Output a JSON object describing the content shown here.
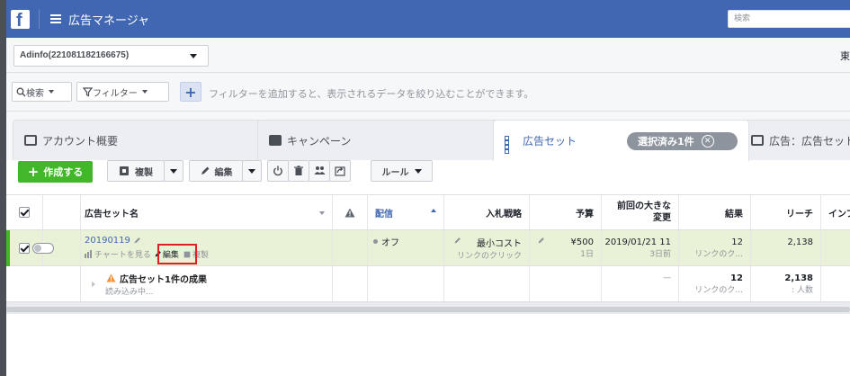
{
  "topbar": {
    "app_title": "広告マネージャ",
    "search_placeholder": "検索"
  },
  "account": {
    "selected": "Adinfo(221081182166675)",
    "right_text": "東"
  },
  "filter_bar": {
    "search_label": "検索",
    "filter_label": "フィルター",
    "hint": "フィルターを追加すると、表示されるデータを絞り込むことができます。"
  },
  "tabs": [
    {
      "label": "アカウント概要",
      "icon": "account-overview-icon"
    },
    {
      "label": "キャンペーン",
      "icon": "campaign-icon"
    },
    {
      "label": "広告セット",
      "icon": "adset-icon",
      "active": true
    },
    {
      "label": "広告：広告セット",
      "icon": "ad-icon"
    }
  ],
  "selected_pill": "選択済み1件",
  "toolbar": {
    "create": "作成する",
    "duplicate": "複製",
    "edit": "編集",
    "rules": "ルール"
  },
  "table": {
    "headers": {
      "name": "広告セット名",
      "delivery": "配信",
      "bid_strategy": "入札戦略",
      "budget": "予算",
      "last_change": "前回の大きな\n変更",
      "results": "結果",
      "reach": "リーチ",
      "impressions": "インプ"
    },
    "row": {
      "name": "20190119",
      "actions": [
        "チャートを見る",
        "編集",
        "複製"
      ],
      "delivery": "オフ",
      "bid_strategy": "最小コスト",
      "bid_strategy_sub": "リンクのクリック",
      "budget": "¥500",
      "budget_sub": "1日",
      "last_change": "2019/01/21 11",
      "last_change_sub": "3日前",
      "results": "12",
      "results_sub": "リンクのク...",
      "reach": "2,138"
    },
    "summary": {
      "title": "広告セット1件の成果",
      "sub": "読み込み中...",
      "last_change": "—",
      "results": "12",
      "results_sub": "リンクのク...",
      "reach": "2,138",
      "reach_sub": ": 人数"
    }
  },
  "colors": {
    "brand_blue": "#4267b2",
    "create_green": "#42b72a",
    "selected_row": "#e9f1d6",
    "highlight_red": "#e02020"
  }
}
